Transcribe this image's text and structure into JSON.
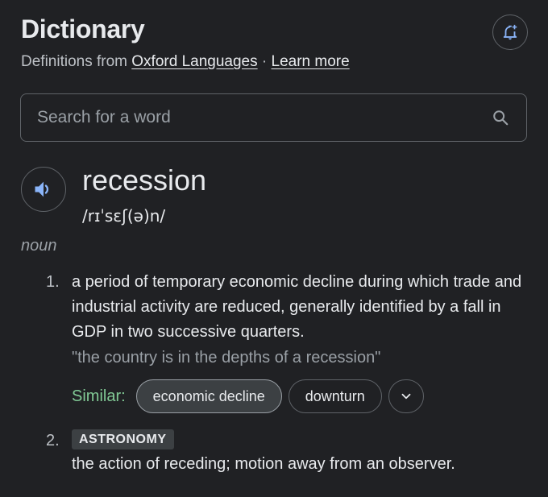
{
  "header": {
    "title": "Dictionary",
    "subtitle_prefix": "Definitions from",
    "source_link": "Oxford Languages",
    "separator": "·",
    "learn_more": "Learn more",
    "bell_icon": "add-alert-icon"
  },
  "search": {
    "placeholder": "Search for a word",
    "value": "",
    "icon": "search-icon"
  },
  "entry": {
    "word": "recession",
    "phonetic": "/rɪˈsɛʃ(ə)n/",
    "part_of_speech": "noun",
    "speaker_icon": "volume-icon",
    "definitions": [
      {
        "number": "1.",
        "text": "a period of temporary economic decline during which trade and industrial activity are reduced, generally identified by a fall in GDP in two successive quarters.",
        "example": "\"the country is in the depths of a recession\"",
        "similar_label": "Similar:",
        "similar": [
          "economic decline",
          "downturn"
        ]
      },
      {
        "number": "2.",
        "tag": "ASTRONOMY",
        "text": "the action of receding; motion away from an observer."
      }
    ]
  },
  "colors": {
    "background": "#202124",
    "text": "#e8eaed",
    "secondary_text": "#9aa0a6",
    "similar_label": "#81c995",
    "speaker_icon": "#8ab4f8",
    "border": "#5f6368"
  }
}
